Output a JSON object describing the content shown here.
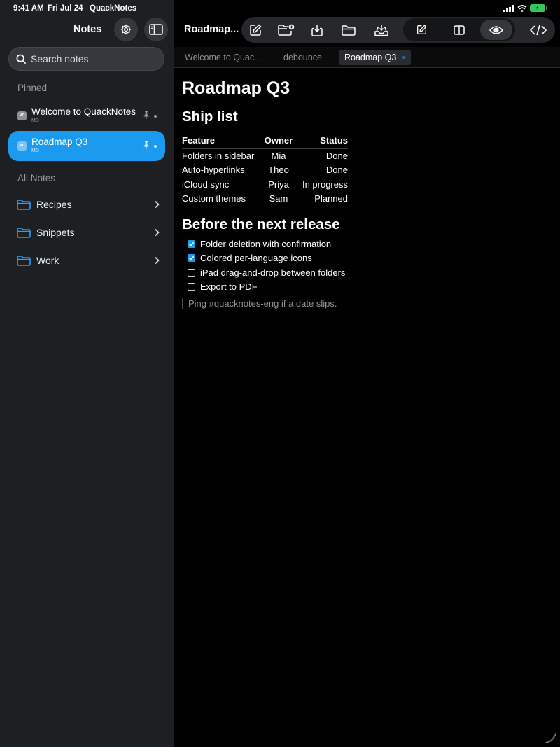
{
  "status_bar": {
    "time": "9:41 AM",
    "date": "Fri Jul 24",
    "app": "QuackNotes"
  },
  "sidebar": {
    "title": "Notes",
    "search_placeholder": "Search notes",
    "pinned_label": "Pinned",
    "pinned": [
      {
        "title": "Welcome to QuackNotes",
        "type": "MD",
        "badge": "MD",
        "active": false
      },
      {
        "title": "Roadmap Q3",
        "type": "MD",
        "badge": "MD",
        "active": true
      }
    ],
    "all_notes_label": "All Notes",
    "folders": [
      {
        "label": "Recipes"
      },
      {
        "label": "Snippets"
      },
      {
        "label": "Work"
      }
    ]
  },
  "header": {
    "doc_title": "Roadmap...",
    "view_mode": "preview",
    "icons": [
      "new-note-icon",
      "new-folder-icon",
      "import-icon",
      "folder-icon",
      "save-icon",
      "edit-mode-icon",
      "split-view-icon",
      "preview-eye-icon",
      "code-icon"
    ]
  },
  "tabs": [
    {
      "label": "Welcome to Quac...",
      "active": false
    },
    {
      "label": "debounce",
      "active": false
    },
    {
      "label": "Roadmap Q3",
      "active": true
    }
  ],
  "document": {
    "h1": "Roadmap Q3",
    "section1_title": "Ship list",
    "table": {
      "headers": [
        "Feature",
        "Owner",
        "Status"
      ],
      "rows": [
        [
          "Folders in sidebar",
          "Mia",
          "Done"
        ],
        [
          "Auto-hyperlinks",
          "Theo",
          "Done"
        ],
        [
          "iCloud sync",
          "Priya",
          "In progress"
        ],
        [
          "Custom themes",
          "Sam",
          "Planned"
        ]
      ]
    },
    "section2_title": "Before the next release",
    "tasks": [
      {
        "label": "Folder deletion with confirmation",
        "checked": true
      },
      {
        "label": "Colored per-language icons",
        "checked": true
      },
      {
        "label": "iPad drag-and-drop between folders",
        "checked": false
      },
      {
        "label": "Export to PDF",
        "checked": false
      }
    ],
    "quote": "Ping #quacknotes-eng if a date slips."
  },
  "colors": {
    "accent": "#1a9bf0",
    "sidebar_bg": "#1d1f22",
    "main_bg": "#000000",
    "folder_icon": "#2f9cf4",
    "battery": "#34c759"
  }
}
